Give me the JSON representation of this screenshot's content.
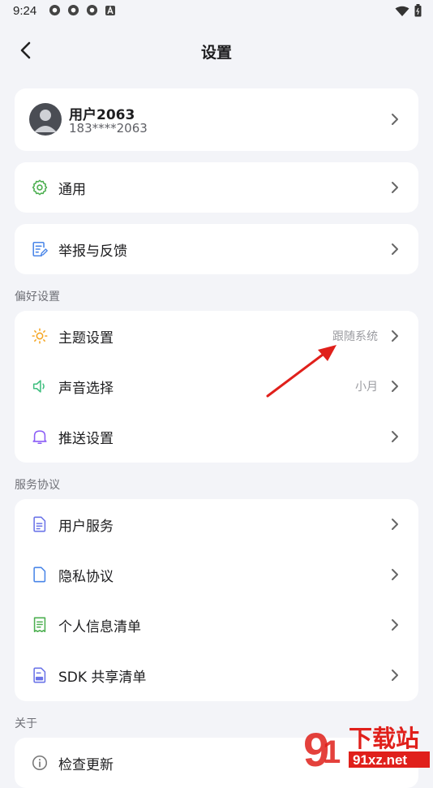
{
  "status_bar": {
    "time": "9:24"
  },
  "header": {
    "title": "设置"
  },
  "profile": {
    "name": "用户2063",
    "phone": "183****2063"
  },
  "menu": {
    "general": "通用",
    "feedback": "举报与反馈"
  },
  "preferences": {
    "section_title": "偏好设置",
    "theme": {
      "label": "主题设置",
      "value": "跟随系统"
    },
    "sound": {
      "label": "声音选择",
      "value": "小月"
    },
    "push": {
      "label": "推送设置"
    }
  },
  "agreements": {
    "section_title": "服务协议",
    "items": [
      "用户服务",
      "隐私协议",
      "个人信息清单",
      "SDK 共享清单"
    ]
  },
  "about": {
    "section_title": "关于",
    "check_update": "检查更新"
  },
  "watermark": {
    "brand": "下载站",
    "site": "91xz.net"
  },
  "colors": {
    "background": "#f3f4f8",
    "card": "#ffffff",
    "general_icon": "#4caf50",
    "feedback_icon": "#4a86e8",
    "theme_icon": "#f5a623",
    "sound_icon": "#3fbf7f",
    "push_icon": "#8a5cf6",
    "doc_icon": "#6b74e8",
    "receipt_icon": "#4caf50",
    "arrow": "#e0201b"
  }
}
